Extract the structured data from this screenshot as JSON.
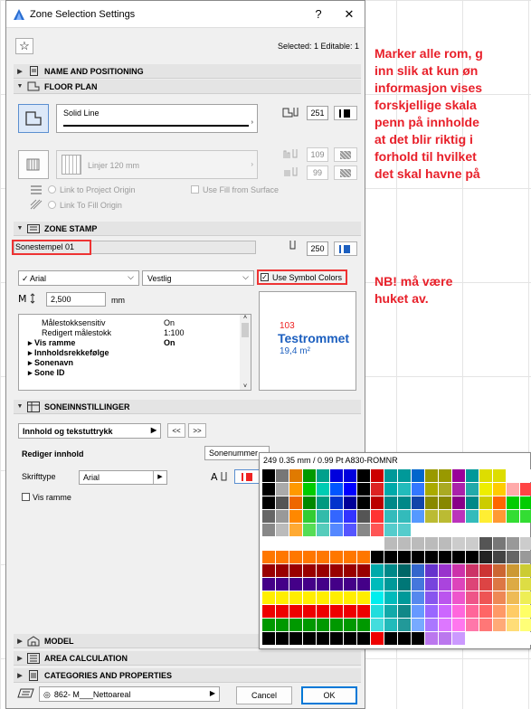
{
  "dialog": {
    "title": "Zone Selection Settings",
    "help": "?",
    "close": "✕",
    "selected_info": "Selected: 1 Editable: 1"
  },
  "sections": {
    "name": "NAME AND POSITIONING",
    "floor": "FLOOR PLAN",
    "stamp": "ZONE STAMP",
    "soneinn": "SONEINNSTILLINGER",
    "model": "MODEL",
    "area": "AREA CALCULATION",
    "categories": "CATEGORIES AND PROPERTIES"
  },
  "floor_plan": {
    "line_type": "Solid Line",
    "pen1": "251",
    "fill_type": "Linjer 120 mm",
    "pen2": "109",
    "pen3": "99",
    "link_project": "Link to Project Origin",
    "link_fill": "Link To Fill Origin",
    "use_fill": "Use Fill from Surface"
  },
  "stamp": {
    "name": "Sonestempel 01",
    "pen": "250",
    "font": "Arial",
    "style": "Vestlig",
    "use_symbol_colors": "Use Symbol Colors",
    "size": "2,500",
    "unit": "mm"
  },
  "params": [
    {
      "k": "Målestokksensitiv",
      "v": "On",
      "bold": false,
      "arrow": false
    },
    {
      "k": "Redigert målestokk",
      "v": "1:100",
      "bold": false,
      "arrow": false
    },
    {
      "k": "Vis ramme",
      "v": "On",
      "bold": true,
      "arrow": true
    },
    {
      "k": "Innholdsrekkefølge",
      "v": "",
      "bold": true,
      "arrow": true
    },
    {
      "k": "Sonenavn",
      "v": "",
      "bold": true,
      "arrow": true
    },
    {
      "k": "Sone ID",
      "v": "",
      "bold": true,
      "arrow": true
    }
  ],
  "preview": {
    "number": "103",
    "name": "Testrommet",
    "area": "19,4 m²"
  },
  "soneinn": {
    "dropdown": "Innhold og tekstuttrykk",
    "prev": "<<",
    "next": ">>",
    "edit_content": "Rediger innhold",
    "edit_value": "Sonenummer",
    "font_label": "Skrifttype",
    "font_value": "Arial",
    "frame": "Vis ramme"
  },
  "palette": {
    "header": "249  0.35 mm / 0.99 Pt A830-ROMNR"
  },
  "footer": {
    "layer": "862- M___Nettoareal",
    "cancel": "Cancel",
    "ok": "OK"
  },
  "notes": {
    "note1": [
      "Marker alle rom, g",
      "inn slik at kun øn",
      "informasjon vises",
      "forskjellige skala",
      "penn på innholde",
      "at det blir riktig i",
      "forhold til hvilket",
      "det skal havne på"
    ],
    "note2": [
      "NB!  må være",
      "huket av."
    ]
  },
  "colors": {
    "accent": "#1c5fbf",
    "note": "#e8202a"
  }
}
